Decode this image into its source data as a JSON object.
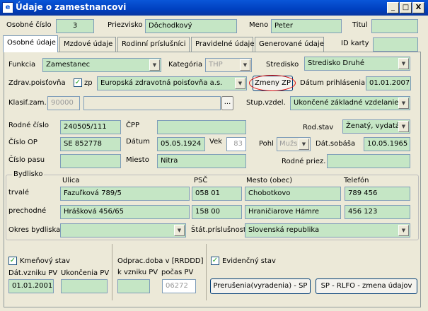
{
  "window": {
    "title": "Údaje o zamestnancovi",
    "app_icon": "e",
    "minimize": "_",
    "maximize": "□",
    "close": "X"
  },
  "header": {
    "osobne_cislo_label": "Osobné číslo",
    "osobne_cislo": "3",
    "priezvisko_label": "Priezvisko",
    "priezvisko": "Dôchodkový",
    "meno_label": "Meno",
    "meno": "Peter",
    "titul_label": "Titul",
    "titul": ""
  },
  "tabs": [
    "Osobné údaje",
    "Mzdové údaje",
    "Rodinní príslušníci",
    "Pravidelné údaje",
    "Generované údaje"
  ],
  "id_karty_label": "ID karty",
  "id_karty": "",
  "form": {
    "funkcia_label": "Funkcia",
    "funkcia": "Zamestanec",
    "kategoria_label": "Kategória",
    "kategoria": "THP",
    "stredisko_label": "Stredisko",
    "stredisko": "Stredisko Druhé",
    "zdrav_label": "Zdrav.poisťovňa",
    "zp_label": "zp",
    "zdrav": "Europská zdravotná poisťovňa a.s.",
    "zmeny_zp": "Zmeny ZP",
    "datum_prihlasenia_label": "Dátum prihlásenia",
    "datum_prihlasenia": "01.01.2007",
    "klasif_label": "Klasif.zam.",
    "klasif": "90000",
    "klasif_dots": "...",
    "stup_vzdel_label": "Stup.vzdel.",
    "stup_vzdel": "Ukončené základné vzdelanie",
    "rodne_cislo_label": "Rodné číslo",
    "rodne_cislo": "240505/111",
    "cpp_label": "ČPP",
    "cpp": "",
    "rod_stav_label": "Rod.stav",
    "rod_stav": "Ženatý, vydatá",
    "cislo_op_label": "Číslo OP",
    "cislo_op": "SE 852778",
    "datum_label": "Dátum",
    "datum": "05.05.1924",
    "vek_label": "Vek",
    "vek": "83",
    "pohl_label": "Pohl",
    "pohl": "Mužs",
    "dat_sobasa_label": "Dát.sobáša",
    "dat_sobasa": "10.05.1965",
    "cislo_pasu_label": "Číslo pasu",
    "cislo_pasu": "",
    "miesto_label": "Miesto",
    "miesto": "Nitra",
    "rodne_priez_label": "Rodné priez.",
    "rodne_priez": ""
  },
  "bydlisko": {
    "title": "Bydlisko",
    "ulica_label": "Ulica",
    "psc_label": "PSČ",
    "mesto_label": "Mesto (obec)",
    "telefon_label": "Telefón",
    "trvale_label": "trvalé",
    "trvale": {
      "ulica": "Fazuľková 789/5",
      "psc": "058 01",
      "mesto": "Chobotkovo",
      "telefon": "789 456"
    },
    "prechodne_label": "prechodné",
    "prechodne": {
      "ulica": "Hrášková 456/65",
      "psc": "158 00",
      "mesto": "Hraničiarove Hámre",
      "telefon": "456 123"
    },
    "okres_label": "Okres bydliska",
    "okres": "",
    "stat_label": "Štát.príslušnosť",
    "stat": "Slovenská republika"
  },
  "bottom": {
    "kmenovy_stav_label": "Kmeňový stav",
    "dat_vzniku_label": "Dát.vzniku PV",
    "dat_vzniku": "01.01.2001",
    "ukoncenia_label": "Ukončenia PV",
    "ukoncenia": "",
    "odprac_label": "Odprac.doba v [RRDDD]",
    "k_vzniku_label": "k vzniku PV",
    "k_vzniku": "",
    "pocas_label": "počas PV",
    "pocas": "06272",
    "evidencny_label": "Evidenčný stav",
    "prerusenia_btn": "Prerušenia(vyradenia) - SP",
    "rlfo_btn": "SP - RLFO - zmena údajov"
  },
  "colors": {
    "field_bg": "#c5e6c5",
    "title_bg": "#0a56d8",
    "window_bg": "#ece9d8",
    "oval": "#e01010"
  },
  "icons": {
    "combo": "▼",
    "check": "✓"
  }
}
